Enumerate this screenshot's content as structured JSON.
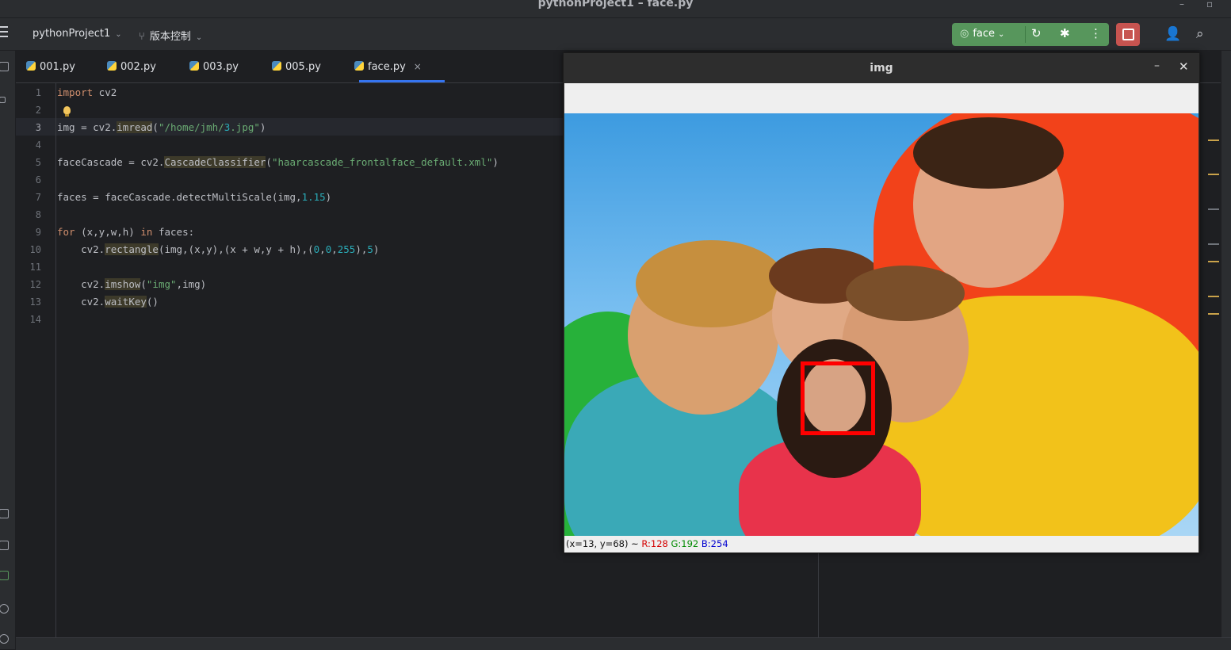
{
  "window": {
    "title": "pythonProject1 – face.py",
    "minimize": "–",
    "maximize": "▫"
  },
  "toolbar": {
    "project": "pythonProject1",
    "vcs": "版本控制",
    "run_config": "face"
  },
  "tabs": [
    {
      "label": "001.py"
    },
    {
      "label": "002.py"
    },
    {
      "label": "003.py"
    },
    {
      "label": "005.py"
    },
    {
      "label": "face.py",
      "active": true,
      "close": "×"
    }
  ],
  "editor": {
    "current_line": 3,
    "line_numbers": [
      "1",
      "2",
      "3",
      "4",
      "5",
      "6",
      "7",
      "8",
      "9",
      "10",
      "11",
      "12",
      "13",
      "14"
    ],
    "lines": [
      "import cv2",
      "",
      "img = cv2.imread(\"/home/jmh/3.jpg\")",
      "",
      "faceCascade = cv2.CascadeClassifier(\"haarcascade_frontalface_default.xml\")",
      "",
      "faces = faceCascade.detectMultiScale(img,1.15)",
      "",
      "for (x,y,w,h) in faces:",
      "    cv2.rectangle(img,(x,y),(x + w,y + h),(0,0,255),5)",
      "",
      "    cv2.imshow(\"img\",img)",
      "    cv2.waitKey()",
      ""
    ]
  },
  "cv_window": {
    "title": "img",
    "minimize": "–",
    "close": "✕",
    "status": {
      "coords": "(x=13, y=68) ~ ",
      "r": "R:128",
      "g": "G:192",
      "b": "B:254"
    }
  },
  "colors": {
    "run_green": "#57965c",
    "stop_red": "#c75450",
    "accent_blue": "#3574f0",
    "face_box": "#ff0000"
  },
  "icons": [
    "menu-icon",
    "branch-icon",
    "rerun-icon",
    "debug-icon",
    "more-icon",
    "stop-icon",
    "add-user-icon",
    "search-icon",
    "python-file-icon",
    "close-icon",
    "bulb-icon"
  ]
}
